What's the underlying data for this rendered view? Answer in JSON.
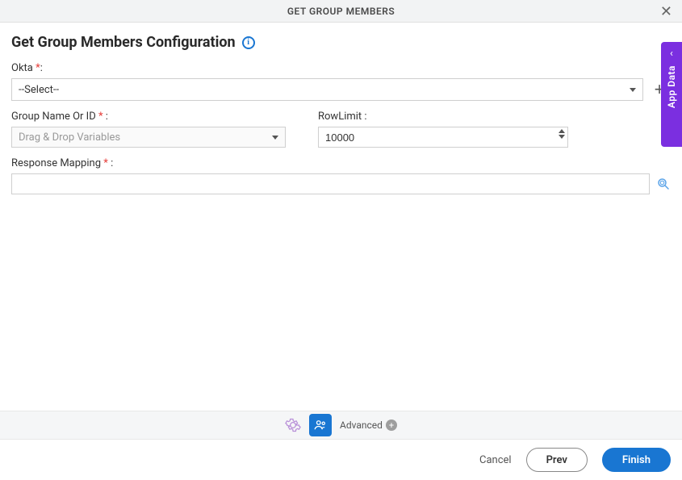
{
  "titleBar": {
    "title": "GET GROUP MEMBERS"
  },
  "header": {
    "pageTitle": "Get Group Members Configuration"
  },
  "fields": {
    "okta": {
      "label": "Okta",
      "required": "*",
      "suffix": ":",
      "selectedValue": "--Select--"
    },
    "groupName": {
      "label": "Group Name Or ID ",
      "required": "*",
      "suffix": " :",
      "placeholder": "Drag & Drop Variables"
    },
    "rowLimit": {
      "label": "RowLimit :",
      "value": "10000"
    },
    "responseMapping": {
      "label": "Response Mapping ",
      "required": "*",
      "suffix": " :",
      "value": ""
    }
  },
  "sidebar": {
    "appData": "App Data"
  },
  "toolbar": {
    "advanced": "Advanced"
  },
  "footer": {
    "cancel": "Cancel",
    "prev": "Prev",
    "finish": "Finish"
  }
}
